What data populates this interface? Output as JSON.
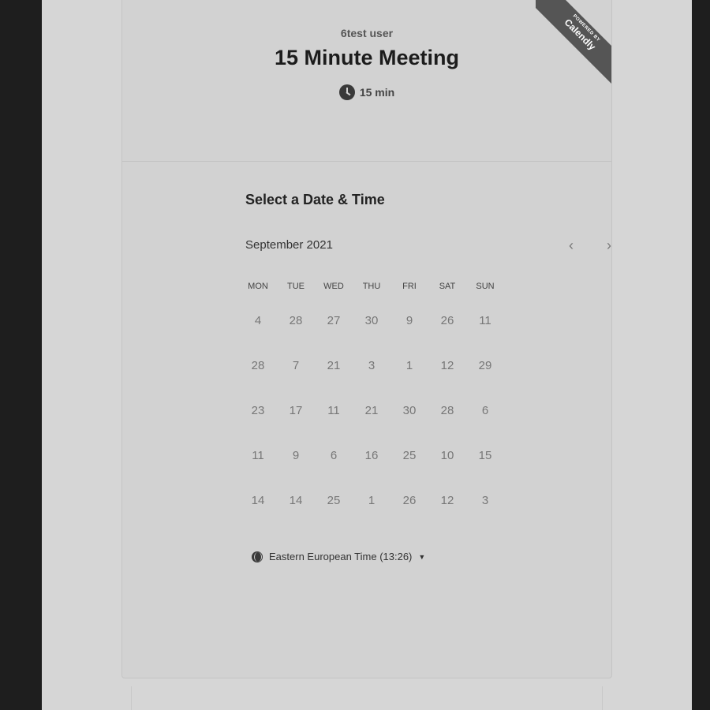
{
  "event": {
    "organizer": "6test user",
    "title": "15 Minute Meeting",
    "duration": "15 min"
  },
  "ribbon": {
    "small_text": "POWERED BY",
    "brand": "Calendly"
  },
  "scheduler": {
    "section_title": "Select a Date & Time",
    "month_label": "September 2021",
    "prev_icon": "chevron-left-icon",
    "next_icon": "chevron-right-icon",
    "weekdays": [
      "MON",
      "TUE",
      "WED",
      "THU",
      "FRI",
      "SAT",
      "SUN"
    ],
    "days": [
      [
        "4",
        "28",
        "27",
        "30",
        "9",
        "26",
        "11"
      ],
      [
        "28",
        "7",
        "21",
        "3",
        "1",
        "12",
        "29"
      ],
      [
        "23",
        "17",
        "11",
        "21",
        "30",
        "28",
        "6"
      ],
      [
        "11",
        "9",
        "6",
        "16",
        "25",
        "10",
        "15"
      ],
      [
        "14",
        "14",
        "25",
        "1",
        "26",
        "12",
        "3"
      ]
    ]
  },
  "timezone": {
    "label": "Eastern European Time (13:26)",
    "icon": "globe-icon"
  },
  "colors": {
    "page_background": "#d6d6d6",
    "card_background": "#d2d2d2",
    "ribbon_background": "#555555",
    "outer_background": "#1e1e1e"
  }
}
